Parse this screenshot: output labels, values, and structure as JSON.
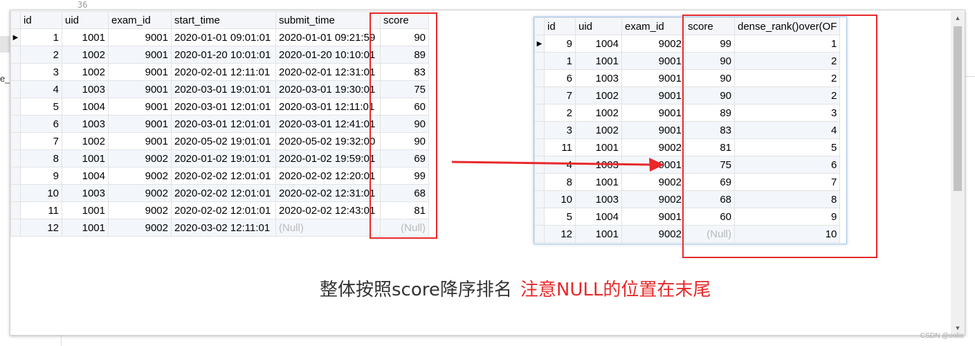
{
  "background": {
    "line_number": "36",
    "left_text": "e_"
  },
  "left_table": {
    "columns": [
      "id",
      "uid",
      "exam_id",
      "start_time",
      "submit_time",
      "score"
    ],
    "current_row_marker": "▶",
    "rows": [
      [
        "1",
        "1001",
        "9001",
        "2020-01-01 09:01:01",
        "2020-01-01 09:21:59",
        "90"
      ],
      [
        "2",
        "1002",
        "9001",
        "2020-01-20 10:01:01",
        "2020-01-20 10:10:01",
        "89"
      ],
      [
        "3",
        "1002",
        "9001",
        "2020-02-01 12:11:01",
        "2020-02-01 12:31:01",
        "83"
      ],
      [
        "4",
        "1003",
        "9001",
        "2020-03-01 19:01:01",
        "2020-03-01 19:30:01",
        "75"
      ],
      [
        "5",
        "1004",
        "9001",
        "2020-03-01 12:01:01",
        "2020-03-01 12:11:01",
        "60"
      ],
      [
        "6",
        "1003",
        "9001",
        "2020-03-01 12:01:01",
        "2020-03-01 12:41:01",
        "90"
      ],
      [
        "7",
        "1002",
        "9001",
        "2020-05-02 19:01:01",
        "2020-05-02 19:32:00",
        "90"
      ],
      [
        "8",
        "1001",
        "9002",
        "2020-01-02 19:01:01",
        "2020-01-02 19:59:01",
        "69"
      ],
      [
        "9",
        "1004",
        "9002",
        "2020-02-02 12:01:01",
        "2020-02-02 12:20:01",
        "99"
      ],
      [
        "10",
        "1003",
        "9002",
        "2020-02-02 12:01:01",
        "2020-02-02 12:31:01",
        "68"
      ],
      [
        "11",
        "1001",
        "9002",
        "2020-02-02 12:01:01",
        "2020-02-02 12:43:01",
        "81"
      ],
      [
        "12",
        "1001",
        "9002",
        "2020-03-02 12:11:01",
        "(Null)",
        "(Null)"
      ]
    ]
  },
  "right_table": {
    "columns": [
      "id",
      "uid",
      "exam_id",
      "score",
      "dense_rank()over(OF"
    ],
    "current_row_marker": "▶",
    "rows": [
      [
        "9",
        "1004",
        "9002",
        "99",
        "1"
      ],
      [
        "1",
        "1001",
        "9001",
        "90",
        "2"
      ],
      [
        "6",
        "1003",
        "9001",
        "90",
        "2"
      ],
      [
        "7",
        "1002",
        "9001",
        "90",
        "2"
      ],
      [
        "2",
        "1002",
        "9001",
        "89",
        "3"
      ],
      [
        "3",
        "1002",
        "9001",
        "83",
        "4"
      ],
      [
        "11",
        "1001",
        "9002",
        "81",
        "5"
      ],
      [
        "4",
        "1003",
        "9001",
        "75",
        "6"
      ],
      [
        "8",
        "1001",
        "9002",
        "69",
        "7"
      ],
      [
        "10",
        "1003",
        "9002",
        "68",
        "8"
      ],
      [
        "5",
        "1004",
        "9001",
        "60",
        "9"
      ],
      [
        "12",
        "1001",
        "9002",
        "(Null)",
        "10"
      ]
    ]
  },
  "caption": {
    "plain": "整体按照score降序排名",
    "highlight": "注意NULL的位置在末尾"
  },
  "watermark": "CSDN @oolio",
  "colors": {
    "highlight_red": "#e8282a",
    "header_bg": "#f4f6f9",
    "null_text": "#b8b8b8"
  }
}
